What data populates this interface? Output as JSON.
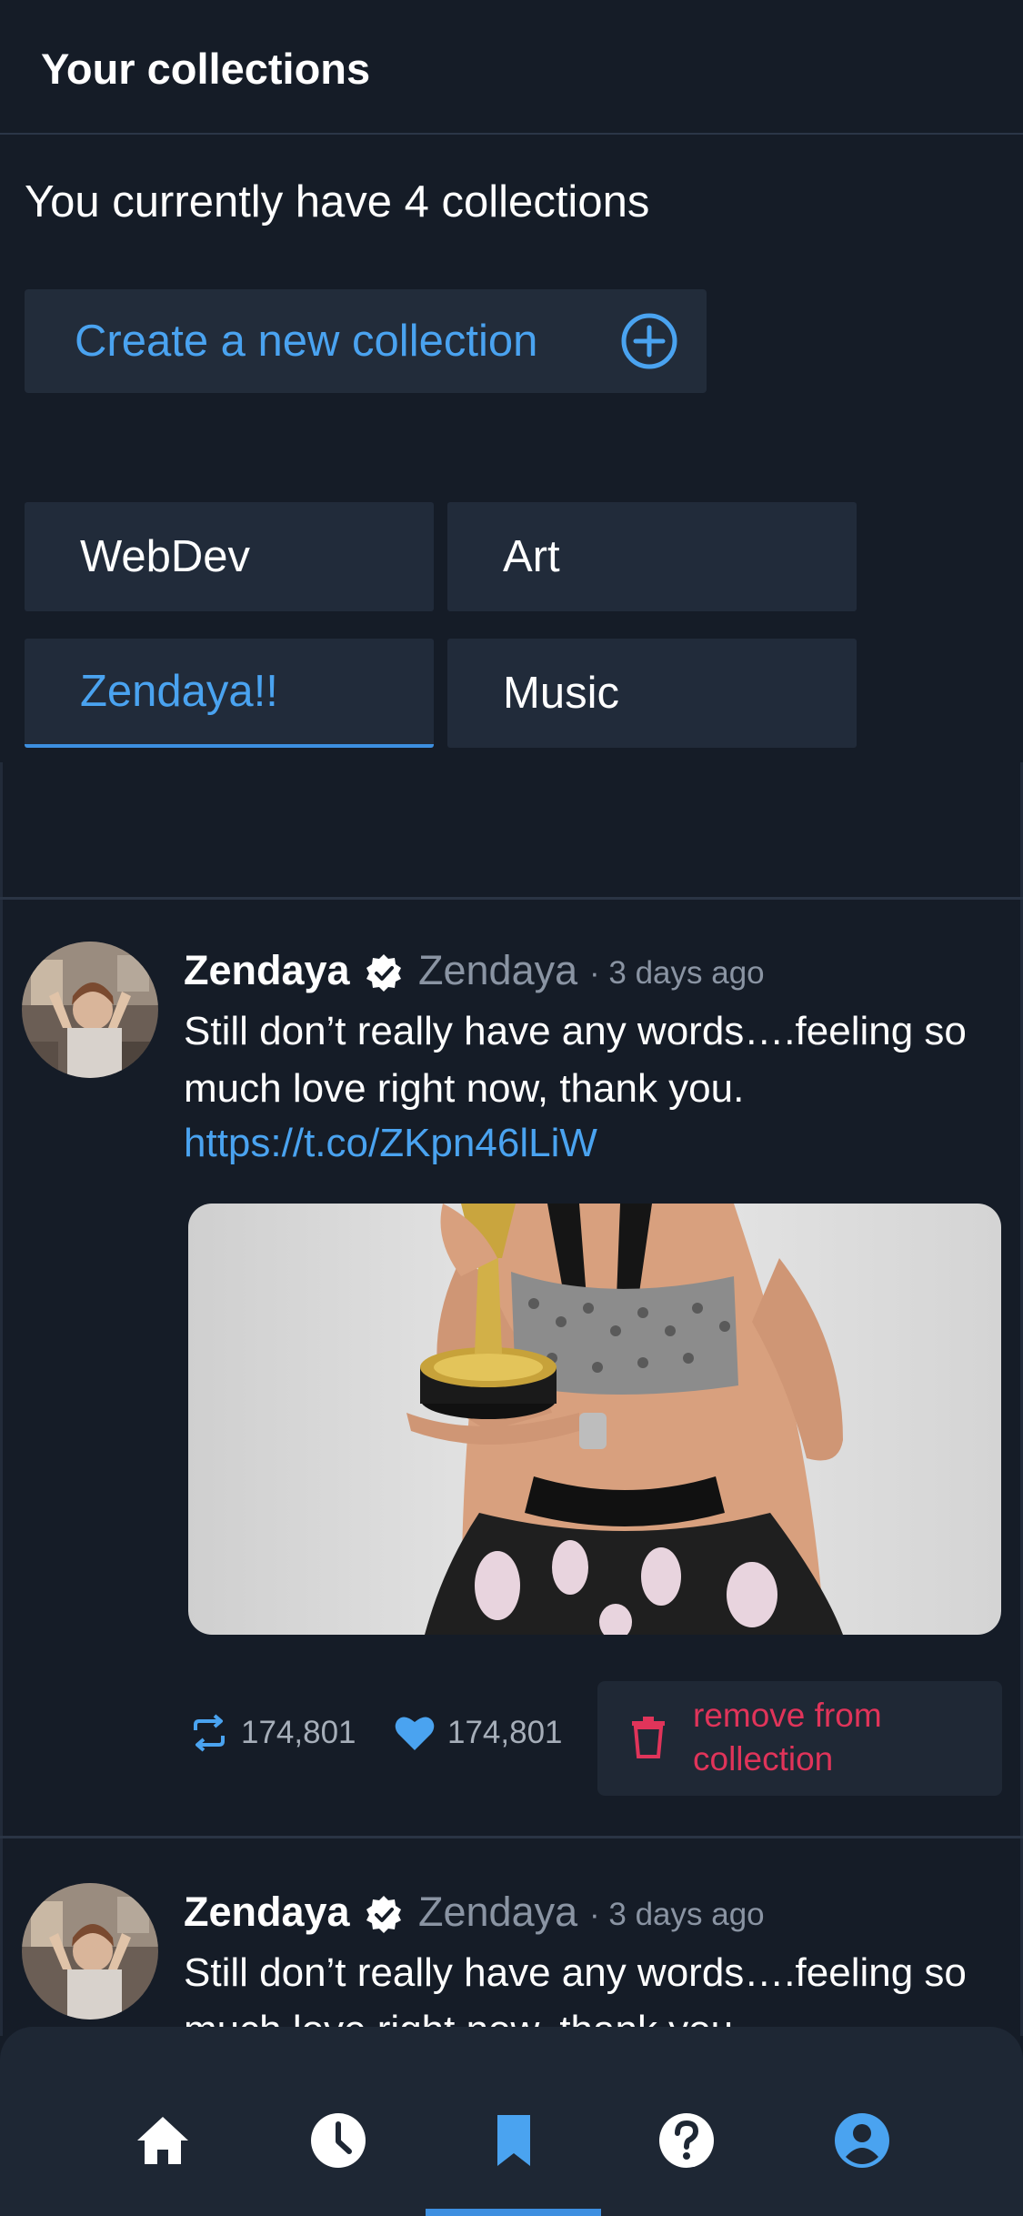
{
  "header": {
    "title": "Your collections"
  },
  "summary": {
    "text": "You currently have 4 collections"
  },
  "create_button": {
    "label": "Create a new collection"
  },
  "collections": [
    {
      "label": "WebDev",
      "active": false
    },
    {
      "label": "Art",
      "active": false
    },
    {
      "label": "Zendaya!!",
      "active": true
    },
    {
      "label": "Music",
      "active": false
    }
  ],
  "tweets": [
    {
      "name": "Zendaya",
      "handle": "Zendaya",
      "time": "· 3 days ago",
      "text": "Still don’t really have any words….feeling so much love right now, thank you.",
      "link": "https://t.co/ZKpn46lLiW",
      "retweets": "174,801",
      "likes": "174,801",
      "remove_label": "remove from collection"
    },
    {
      "name": "Zendaya",
      "handle": "Zendaya",
      "time": "· 3 days ago",
      "text": "Still don’t really have any words….feeling so much love right now, thank you."
    }
  ],
  "colors": {
    "background": "#151c27",
    "accent": "#4aa3f0",
    "danger": "#e0345a",
    "verified": "#ffffff"
  },
  "nav": {
    "items": [
      "home-icon",
      "history-icon",
      "bookmark-icon",
      "help-icon",
      "profile-icon"
    ],
    "active": "bookmark-icon"
  }
}
